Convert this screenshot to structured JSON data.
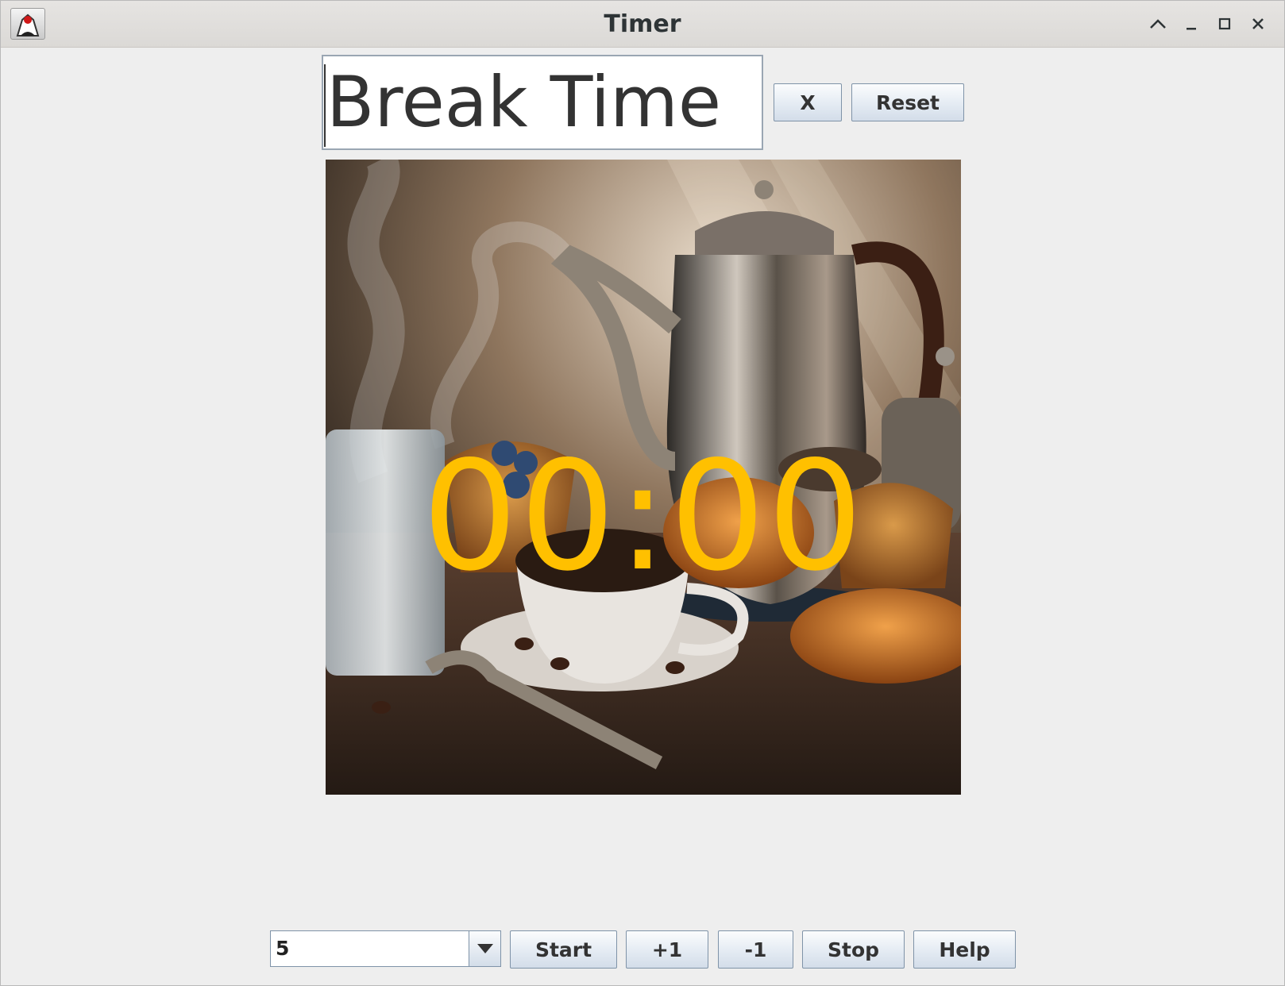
{
  "window": {
    "title": "Timer",
    "controls": [
      "minimize-up",
      "minimize",
      "maximize",
      "close"
    ]
  },
  "header": {
    "title_input_value": "Break Time",
    "clear_button_label": "X",
    "reset_button_label": "Reset"
  },
  "display": {
    "time": "00:00",
    "time_color": "#ffc000",
    "image_subject": "coffee pot, cup of coffee, glass of water, muffins and croissants on a table"
  },
  "controls": {
    "minutes_select_value": "5",
    "start_label": "Start",
    "plus_one_label": "+1",
    "minus_one_label": "-1",
    "stop_label": "Stop",
    "help_label": "Help"
  },
  "colors": {
    "window_bg": "#eeeeee",
    "titlebar_bg": "#dcdad7",
    "button_border": "#7f93a8"
  }
}
